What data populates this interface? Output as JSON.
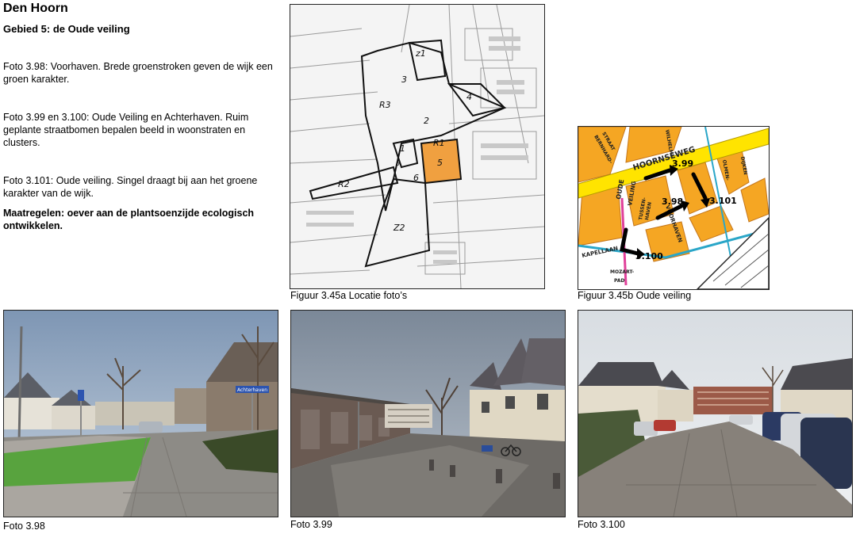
{
  "header": {
    "title": "Den Hoorn",
    "subtitle": "Gebied 5: de Oude veiling"
  },
  "paragraphs": [
    "Foto 3.98: Voorhaven. Brede groenstroken geven de wijk een groen karakter.",
    "Foto 3.99 en 3.100: Oude Veiling en Achterhaven. Ruim geplante straatbomen bepalen beeld in woonstraten en clusters.",
    "Foto 3.101: Oude veiling. Singel draagt bij aan het groene karakter van de wijk."
  ],
  "measures": "Maatregelen: oever aan de plantsoenzijde ecologisch ontwikkelen.",
  "figures": {
    "map_a": {
      "caption": "Figuur 3.45a Locatie foto’s",
      "zones": [
        "z1",
        "3",
        "R3",
        "2",
        "4",
        "1",
        "R1",
        "5",
        "5",
        "6",
        "R2",
        "Z2"
      ]
    },
    "map_b": {
      "caption": "Figuur 3.45b Oude veiling",
      "street_labels": [
        "HOORNSEWEG",
        "BERNHARD-",
        "STRAAT",
        "WILHELMI",
        "OUDE",
        "VEILING",
        "TUSSEN-",
        "HAVEN",
        "VOORHAVEN",
        "KAPELLAAN",
        "MOZART-",
        "PAD",
        "OLMEN-",
        "DIJKEN"
      ],
      "photo_points": [
        "3.99",
        "3.98",
        "3.101",
        "3.100"
      ]
    }
  },
  "photos": [
    {
      "caption": "Foto 3.98",
      "sign_text": "Achterhaven"
    },
    {
      "caption": "Foto 3.99"
    },
    {
      "caption": "Foto 3.100"
    }
  ],
  "colors": {
    "map_orange": "#f5a623",
    "street_yellow": "#ffe400",
    "zone_orange": "#f0a040",
    "sky": "#8fa4b8"
  }
}
